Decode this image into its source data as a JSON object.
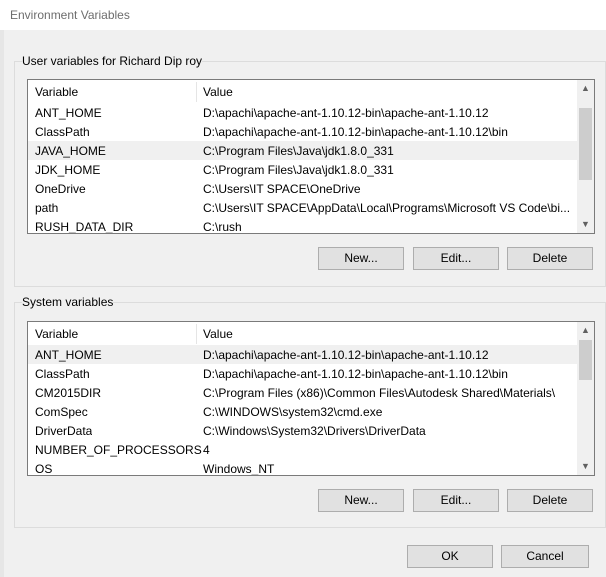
{
  "window": {
    "title": "Environment Variables"
  },
  "user_section": {
    "label": "User variables for Richard Dip roy",
    "columns": [
      "Variable",
      "Value"
    ],
    "rows": [
      {
        "variable": "ANT_HOME",
        "value": "D:\\apachi\\apache-ant-1.10.12-bin\\apache-ant-1.10.12"
      },
      {
        "variable": "ClassPath",
        "value": "D:\\apachi\\apache-ant-1.10.12-bin\\apache-ant-1.10.12\\bin"
      },
      {
        "variable": "JAVA_HOME",
        "value": "C:\\Program Files\\Java\\jdk1.8.0_331"
      },
      {
        "variable": "JDK_HOME",
        "value": "C:\\Program Files\\Java\\jdk1.8.0_331"
      },
      {
        "variable": "OneDrive",
        "value": "C:\\Users\\IT SPACE\\OneDrive"
      },
      {
        "variable": "path",
        "value": "C:\\Users\\IT SPACE\\AppData\\Local\\Programs\\Microsoft VS Code\\bi..."
      },
      {
        "variable": "RUSH_DATA_DIR",
        "value": "C:\\rush"
      }
    ],
    "selected_index": 2,
    "buttons": {
      "new": "New...",
      "edit": "Edit...",
      "delete": "Delete"
    }
  },
  "system_section": {
    "label": "System variables",
    "columns": [
      "Variable",
      "Value"
    ],
    "rows": [
      {
        "variable": "ANT_HOME",
        "value": "D:\\apachi\\apache-ant-1.10.12-bin\\apache-ant-1.10.12"
      },
      {
        "variable": "ClassPath",
        "value": "D:\\apachi\\apache-ant-1.10.12-bin\\apache-ant-1.10.12\\bin"
      },
      {
        "variable": "CM2015DIR",
        "value": "C:\\Program Files (x86)\\Common Files\\Autodesk Shared\\Materials\\"
      },
      {
        "variable": "ComSpec",
        "value": "C:\\WINDOWS\\system32\\cmd.exe"
      },
      {
        "variable": "DriverData",
        "value": "C:\\Windows\\System32\\Drivers\\DriverData"
      },
      {
        "variable": "NUMBER_OF_PROCESSORS",
        "value": "4"
      },
      {
        "variable": "OS",
        "value": "Windows_NT"
      }
    ],
    "selected_index": 0,
    "buttons": {
      "new": "New...",
      "edit": "Edit...",
      "delete": "Delete"
    }
  },
  "footer": {
    "ok": "OK",
    "cancel": "Cancel"
  },
  "icons": {
    "scroll_up": "chevron-up-icon",
    "scroll_down": "chevron-down-icon"
  }
}
